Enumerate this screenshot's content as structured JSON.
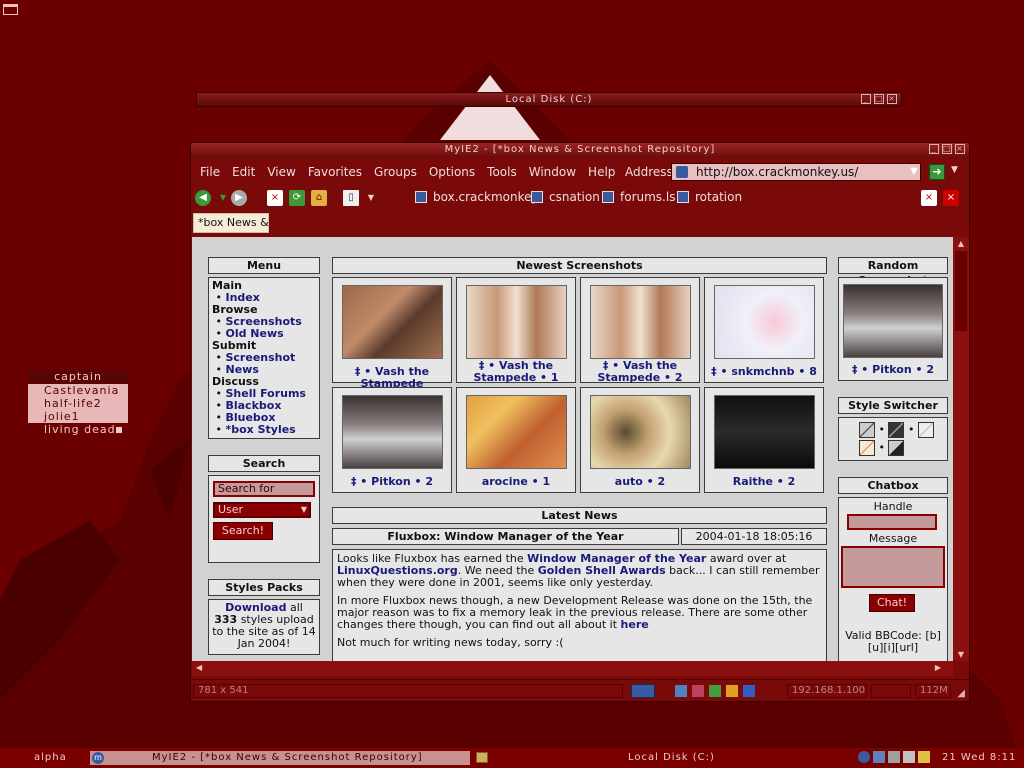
{
  "colors": {
    "desktop": "#6a0000",
    "accent": "#8a0000",
    "link": "#1a1a7a"
  },
  "localdisk": {
    "title": "Local Disk (C:)"
  },
  "captain_menu": {
    "title": "captain",
    "items": [
      "Castlevania",
      "half-life2",
      "jolie1"
    ],
    "inactive": "living dead"
  },
  "browser": {
    "title": "MyIE2 - [*box News & Screenshot Repository]",
    "menus": [
      "File",
      "Edit",
      "View",
      "Favorites",
      "Groups",
      "Options",
      "Tools",
      "Window",
      "Help"
    ],
    "address_label": "Address",
    "address": "http://box.crackmonkey.us/",
    "bookmarks": [
      "box.crackmonkey",
      "csnation",
      "forums.ls",
      "rotation"
    ],
    "tab": "*box News & ...",
    "status": {
      "size": "781 x 541",
      "ip": "192.168.1.100",
      "mem": "112M"
    }
  },
  "page": {
    "menu": {
      "title": "Menu",
      "groups": [
        {
          "h": "Main",
          "items": [
            "Index"
          ]
        },
        {
          "h": "Browse",
          "items": [
            "Screenshots",
            "Old News"
          ]
        },
        {
          "h": "Submit",
          "items": [
            "Screenshot",
            "News"
          ]
        },
        {
          "h": "Discuss",
          "items": [
            "Shell Forums",
            "Blackbox",
            "Bluebox",
            "*box Styles"
          ]
        }
      ]
    },
    "search": {
      "title": "Search",
      "placeholder": "Search for",
      "select": "User",
      "button": "Search!"
    },
    "styles": {
      "title": "Styles Packs",
      "link": "Download",
      "text1": "all",
      "count": "333",
      "text2": "styles upload to the site as of 14 Jan 2004!"
    },
    "newest": {
      "title": "Newest Screenshots",
      "items": [
        {
          "cap": "‡ • Vash the Stampede"
        },
        {
          "cap": "‡ • Vash the Stampede • 1"
        },
        {
          "cap": "‡ • Vash the Stampede • 2"
        },
        {
          "cap": "‡ • snkmchnb • 8"
        },
        {
          "cap": "‡ • Pitkon • 2"
        },
        {
          "cap": "arocine • 1"
        },
        {
          "cap": "auto • 2"
        },
        {
          "cap": "Raithe • 2"
        }
      ]
    },
    "news": {
      "title": "Latest News",
      "headline": "Fluxbox: Window Manager of the Year",
      "date": "2004-01-18 18:05:16",
      "p1a": "Looks like Fluxbox has earned the ",
      "p1l1": "Window Manager of the Year",
      "p1b": " award over at ",
      "p1l2": "LinuxQuestions.org",
      "p1c": ". We need the ",
      "p1l3": "Golden Shell Awards",
      "p1d": " back... I can still remember when they were done in 2001, seems like only yesterday.",
      "p2a": "In more Fluxbox news though, a new Development Release was done on the 15th, the major reason was to fix a memory leak in the previous release. There are some other changes there though, you can find out all about it ",
      "p2l": "here",
      "p3": "Not much for writing news today, sorry :("
    },
    "random": {
      "title": "Random Screenshot",
      "cap": "‡ • Pitkon • 2"
    },
    "switcher": {
      "title": "Style Switcher"
    },
    "chat": {
      "title": "Chatbox",
      "handle": "Handle",
      "message": "Message",
      "button": "Chat!",
      "bbcode": "Valid BBCode: [b] [u][i][url]"
    }
  },
  "taskbar": {
    "workspace": "alpha",
    "task1": "MyIE2 - [*box News & Screenshot Repository]",
    "task2": "Local Disk (C:)",
    "clock": "21 Wed 8:11"
  }
}
